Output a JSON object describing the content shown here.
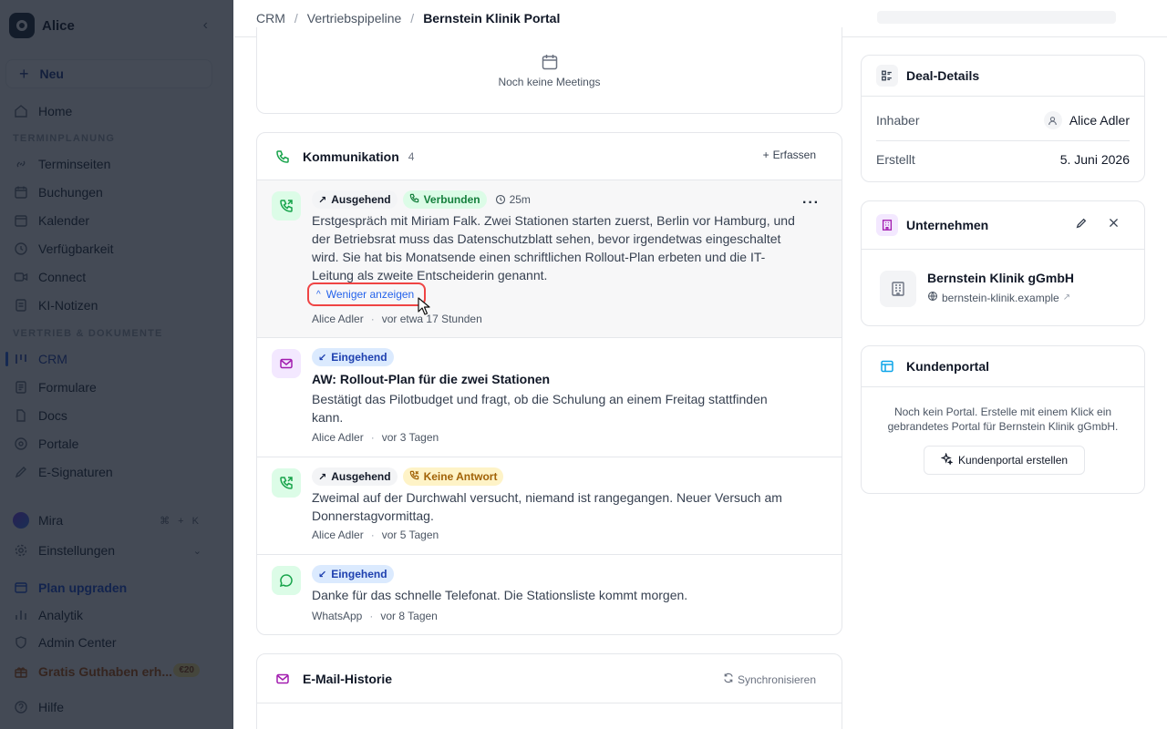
{
  "sidebar": {
    "workspace": "Alice",
    "new_label": "Neu",
    "items_top": [
      {
        "label": "Home",
        "icon": "home-icon"
      }
    ],
    "section1": "TERMINPLANUNG",
    "items_sched": [
      {
        "label": "Terminseiten",
        "icon": "link-icon"
      },
      {
        "label": "Buchungen",
        "icon": "calendar-icon"
      },
      {
        "label": "Kalender",
        "icon": "calendar-icon"
      },
      {
        "label": "Verfügbarkeit",
        "icon": "clock-icon"
      },
      {
        "label": "Connect",
        "icon": "video-icon"
      },
      {
        "label": "KI-Notizen",
        "icon": "note-icon"
      }
    ],
    "section2": "VERTRIEB & DOKUMENTE",
    "items_sales": [
      {
        "label": "CRM",
        "icon": "kanban-icon"
      },
      {
        "label": "Formulare",
        "icon": "form-icon"
      },
      {
        "label": "Docs",
        "icon": "doc-icon"
      },
      {
        "label": "Portale",
        "icon": "portal-icon"
      },
      {
        "label": "E-Signaturen",
        "icon": "pen-icon"
      }
    ],
    "mira": "Mira",
    "mira_shortcut": "⌘ + K",
    "settings": "Einstellungen",
    "upgrade": "Plan upgraden",
    "analytics": "Analytik",
    "admin": "Admin Center",
    "gratis": "Gratis Guthaben erh...",
    "gratis_badge": "€20",
    "help": "Hilfe"
  },
  "breadcrumb": {
    "items": [
      "CRM",
      "Vertriebspipeline"
    ],
    "current": "Bernstein Klinik Portal"
  },
  "meetings": {
    "empty": "Noch keine Meetings"
  },
  "communication": {
    "title": "Kommunikation",
    "count": "4",
    "add_label": "Erfassen",
    "entries": [
      {
        "direction": "Ausgehend",
        "status": "Verbunden",
        "duration": "25m",
        "body": "Erstgespräch mit Miriam Falk. Zwei Stationen starten zuerst, Berlin vor Hamburg, und der Betriebsrat muss das Datenschutzblatt sehen, bevor irgendetwas eingeschaltet wird. Sie hat bis Monatsende einen schriftlichen Rollout-Plan erbeten und die IT-Leitung als zweite Entscheiderin genannt.",
        "toggle": "Weniger anzeigen",
        "author": "Alice Adler",
        "time": "vor etwa 17 Stunden"
      },
      {
        "direction": "Eingehend",
        "subject": "AW: Rollout-Plan für die zwei Stationen",
        "body": "Bestätigt das Pilotbudget und fragt, ob die Schulung an einem Freitag stattfinden kann.",
        "author": "Alice Adler",
        "time": "vor 3 Tagen"
      },
      {
        "direction": "Ausgehend",
        "status": "Keine Antwort",
        "body": "Zweimal auf der Durchwahl versucht, niemand ist rangegangen. Neuer Versuch am Donnerstagvormittag.",
        "author": "Alice Adler",
        "time": "vor 5 Tagen"
      },
      {
        "direction": "Eingehend",
        "body": "Danke für das schnelle Telefonat. Die Stationsliste kommt morgen.",
        "author": "WhatsApp",
        "time": "vor 8 Tagen"
      }
    ]
  },
  "email_history": {
    "title": "E-Mail-Historie",
    "sync_label": "Synchronisieren"
  },
  "deal": {
    "title": "Deal-Details",
    "owner_label": "Inhaber",
    "owner": "Alice Adler",
    "created_label": "Erstellt",
    "created": "5. Juni 2026"
  },
  "company": {
    "title": "Unternehmen",
    "name": "Bernstein Klinik gGmbH",
    "url": "bernstein-klinik.example"
  },
  "portal": {
    "title": "Kundenportal",
    "text": "Noch kein Portal. Erstelle mit einem Klick ein gebrandetes Portal für Bernstein Klinik gGmbH.",
    "button": "Kundenportal erstellen"
  },
  "colors": {
    "accent": "#2563eb",
    "green": "#16a34a",
    "purple": "#a21caf",
    "highlight_ring": "#ef4444"
  }
}
